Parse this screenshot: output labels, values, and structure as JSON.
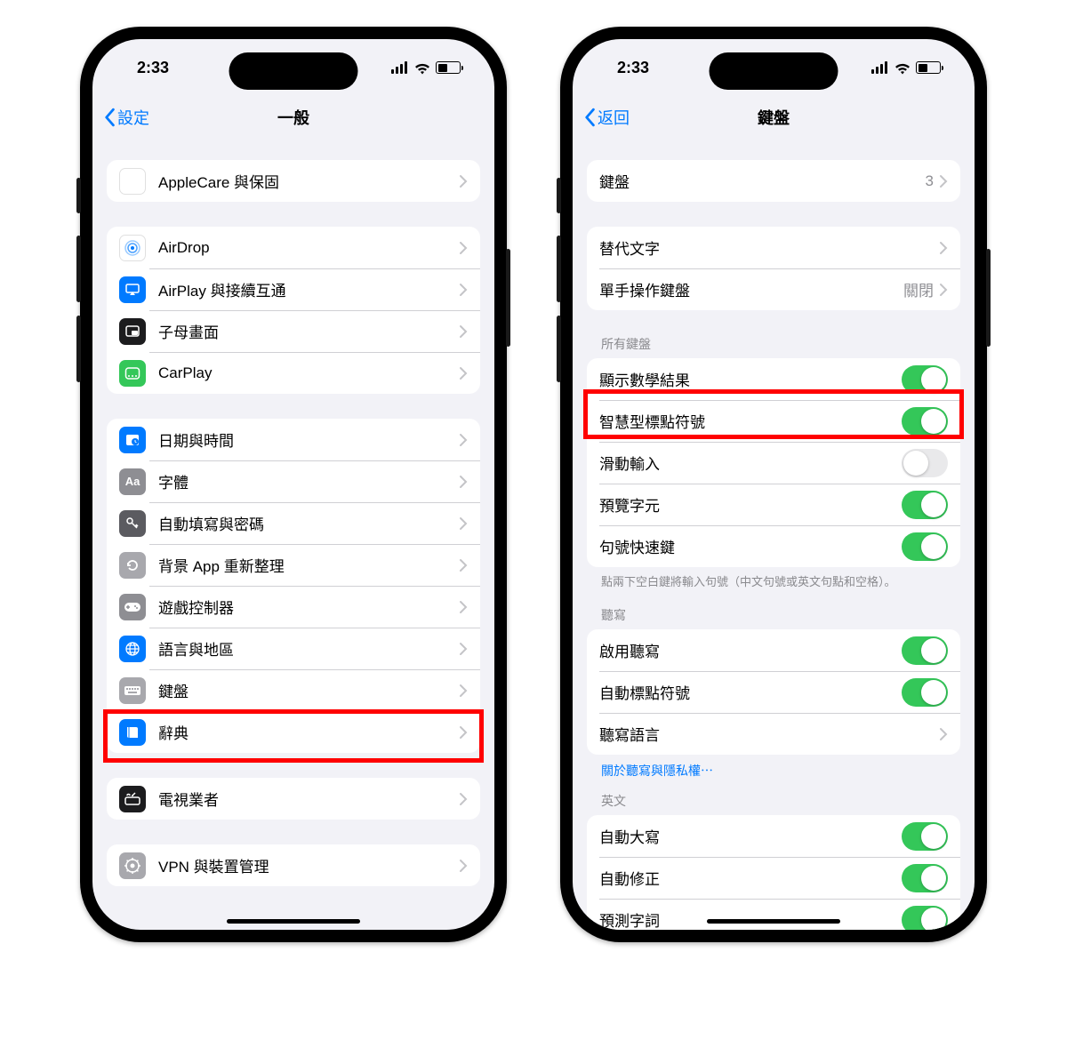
{
  "status": {
    "time": "2:33"
  },
  "phone1": {
    "back": "設定",
    "title": "一般",
    "groups": [
      {
        "rows": [
          {
            "label": "AppleCare 與保固"
          }
        ]
      },
      {
        "rows": [
          {
            "label": "AirDrop"
          },
          {
            "label": "AirPlay 與接續互通"
          },
          {
            "label": "子母畫面"
          },
          {
            "label": "CarPlay"
          }
        ]
      },
      {
        "rows": [
          {
            "label": "日期與時間"
          },
          {
            "label": "字體"
          },
          {
            "label": "自動填寫與密碼"
          },
          {
            "label": "背景 App 重新整理"
          },
          {
            "label": "遊戲控制器"
          },
          {
            "label": "語言與地區"
          },
          {
            "label": "鍵盤"
          },
          {
            "label": "辭典"
          }
        ]
      },
      {
        "rows": [
          {
            "label": "電視業者"
          }
        ]
      },
      {
        "rows": [
          {
            "label": "VPN 與裝置管理"
          }
        ]
      }
    ]
  },
  "phone2": {
    "back": "返回",
    "title": "鍵盤",
    "g1": {
      "keyboards_label": "鍵盤",
      "keyboards_count": "3"
    },
    "g2": {
      "text_replace": "替代文字",
      "one_handed": "單手操作鍵盤",
      "one_handed_value": "關閉"
    },
    "all_kb_header": "所有鍵盤",
    "g3": {
      "math": "顯示數學結果",
      "smart_punct": "智慧型標點符號",
      "slide": "滑動輸入",
      "preview": "預覽字元",
      "period": "句號快速鍵"
    },
    "g3_footer": "點兩下空白鍵將輸入句號（中文句號或英文句點和空格）。",
    "dict_header": "聽寫",
    "g4": {
      "enable_dict": "啟用聽寫",
      "auto_punct": "自動標點符號",
      "dict_lang": "聽寫語言"
    },
    "dict_link": "關於聽寫與隱私權⋯",
    "en_header": "英文",
    "g5": {
      "autocap": "自動大寫",
      "autocorrect": "自動修正",
      "predictive": "預測字詞"
    }
  }
}
